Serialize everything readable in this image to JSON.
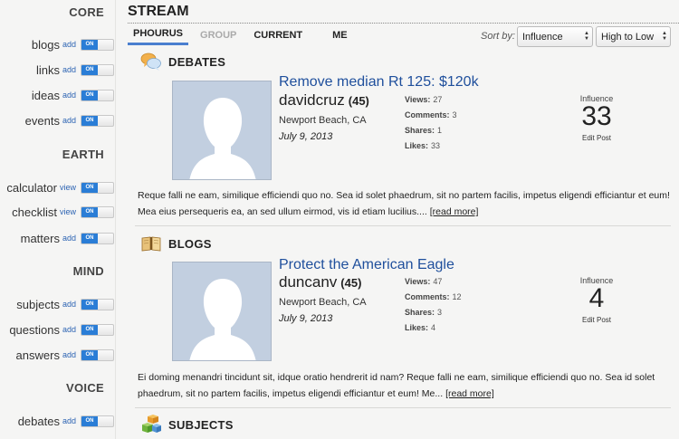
{
  "sidebar": {
    "sections": {
      "core": "CORE",
      "earth": "EARTH",
      "mind": "MIND",
      "voice": "VOICE"
    },
    "items": [
      {
        "label": "blogs",
        "link": "add",
        "toggle": "ON"
      },
      {
        "label": "links",
        "link": "add",
        "toggle": "ON"
      },
      {
        "label": "ideas",
        "link": "add",
        "toggle": "ON"
      },
      {
        "label": "events",
        "link": "add",
        "toggle": "ON"
      },
      {
        "label": "calculator",
        "link": "view",
        "toggle": "ON"
      },
      {
        "label": "checklist",
        "link": "view",
        "toggle": "ON"
      },
      {
        "label": "matters",
        "link": "add",
        "toggle": "ON"
      },
      {
        "label": "subjects",
        "link": "add",
        "toggle": "ON"
      },
      {
        "label": "questions",
        "link": "add",
        "toggle": "ON"
      },
      {
        "label": "answers",
        "link": "add",
        "toggle": "ON"
      },
      {
        "label": "debates",
        "link": "add",
        "toggle": "ON"
      }
    ]
  },
  "main": {
    "title": "STREAM",
    "tabs": [
      {
        "label": "PHOURUS",
        "state": "active"
      },
      {
        "label": "GROUP",
        "state": "disabled"
      },
      {
        "label": "CURRENT",
        "state": "normal"
      },
      {
        "label": "ME",
        "state": "normal"
      }
    ],
    "sort": {
      "label": "Sort by:",
      "field": "Influence",
      "order": "High to Low"
    }
  },
  "posts": [
    {
      "section": "DEBATES",
      "section_icon": "speech-bubbles-icon",
      "title": "Remove median Rt 125: $120k",
      "user": "davidcruz",
      "rep": "(45)",
      "location": "Newport Beach, CA",
      "date": "July 9, 2013",
      "stats": [
        {
          "label": "Views:",
          "value": "27"
        },
        {
          "label": "Comments:",
          "value": "3"
        },
        {
          "label": "Shares:",
          "value": "1"
        },
        {
          "label": "Likes:",
          "value": "33"
        }
      ],
      "influence_label": "Influence",
      "influence": "33",
      "edit": "Edit Post",
      "excerpt": "Reque falli ne eam, similique efficiendi quo no. Sea id solet phaedrum, sit no partem facilis, impetus eligendi efficiantur et eum! Mea eius persequeris ea, an sed ullum eirmod, vis id etiam lucilius....",
      "read_more": "[read more]"
    },
    {
      "section": "BLOGS",
      "section_icon": "open-book-icon",
      "title": "Protect the American Eagle",
      "user": "duncanv",
      "rep": "(45)",
      "location": "Newport Beach, CA",
      "date": "July 9, 2013",
      "stats": [
        {
          "label": "Views:",
          "value": "47"
        },
        {
          "label": "Comments:",
          "value": "12"
        },
        {
          "label": "Shares:",
          "value": "3"
        },
        {
          "label": "Likes:",
          "value": "4"
        }
      ],
      "influence_label": "Influence",
      "influence": "4",
      "edit": "Edit Post",
      "excerpt": "Ei doming menandri tincidunt sit, idque oratio hendrerit id nam? Reque falli ne eam, similique efficiendi quo no. Sea id solet phaedrum, sit no partem facilis, impetus eligendi efficiantur et eum! Me...",
      "read_more": "[read more]"
    }
  ],
  "next_section": {
    "label": "SUBJECTS",
    "icon": "cubes-icon"
  },
  "colors": {
    "accent": "#2a7dd6",
    "title_link": "#1f4f9c",
    "tab_underline": "#4a7fcf",
    "avatar_bg": "#c2cfe0"
  }
}
